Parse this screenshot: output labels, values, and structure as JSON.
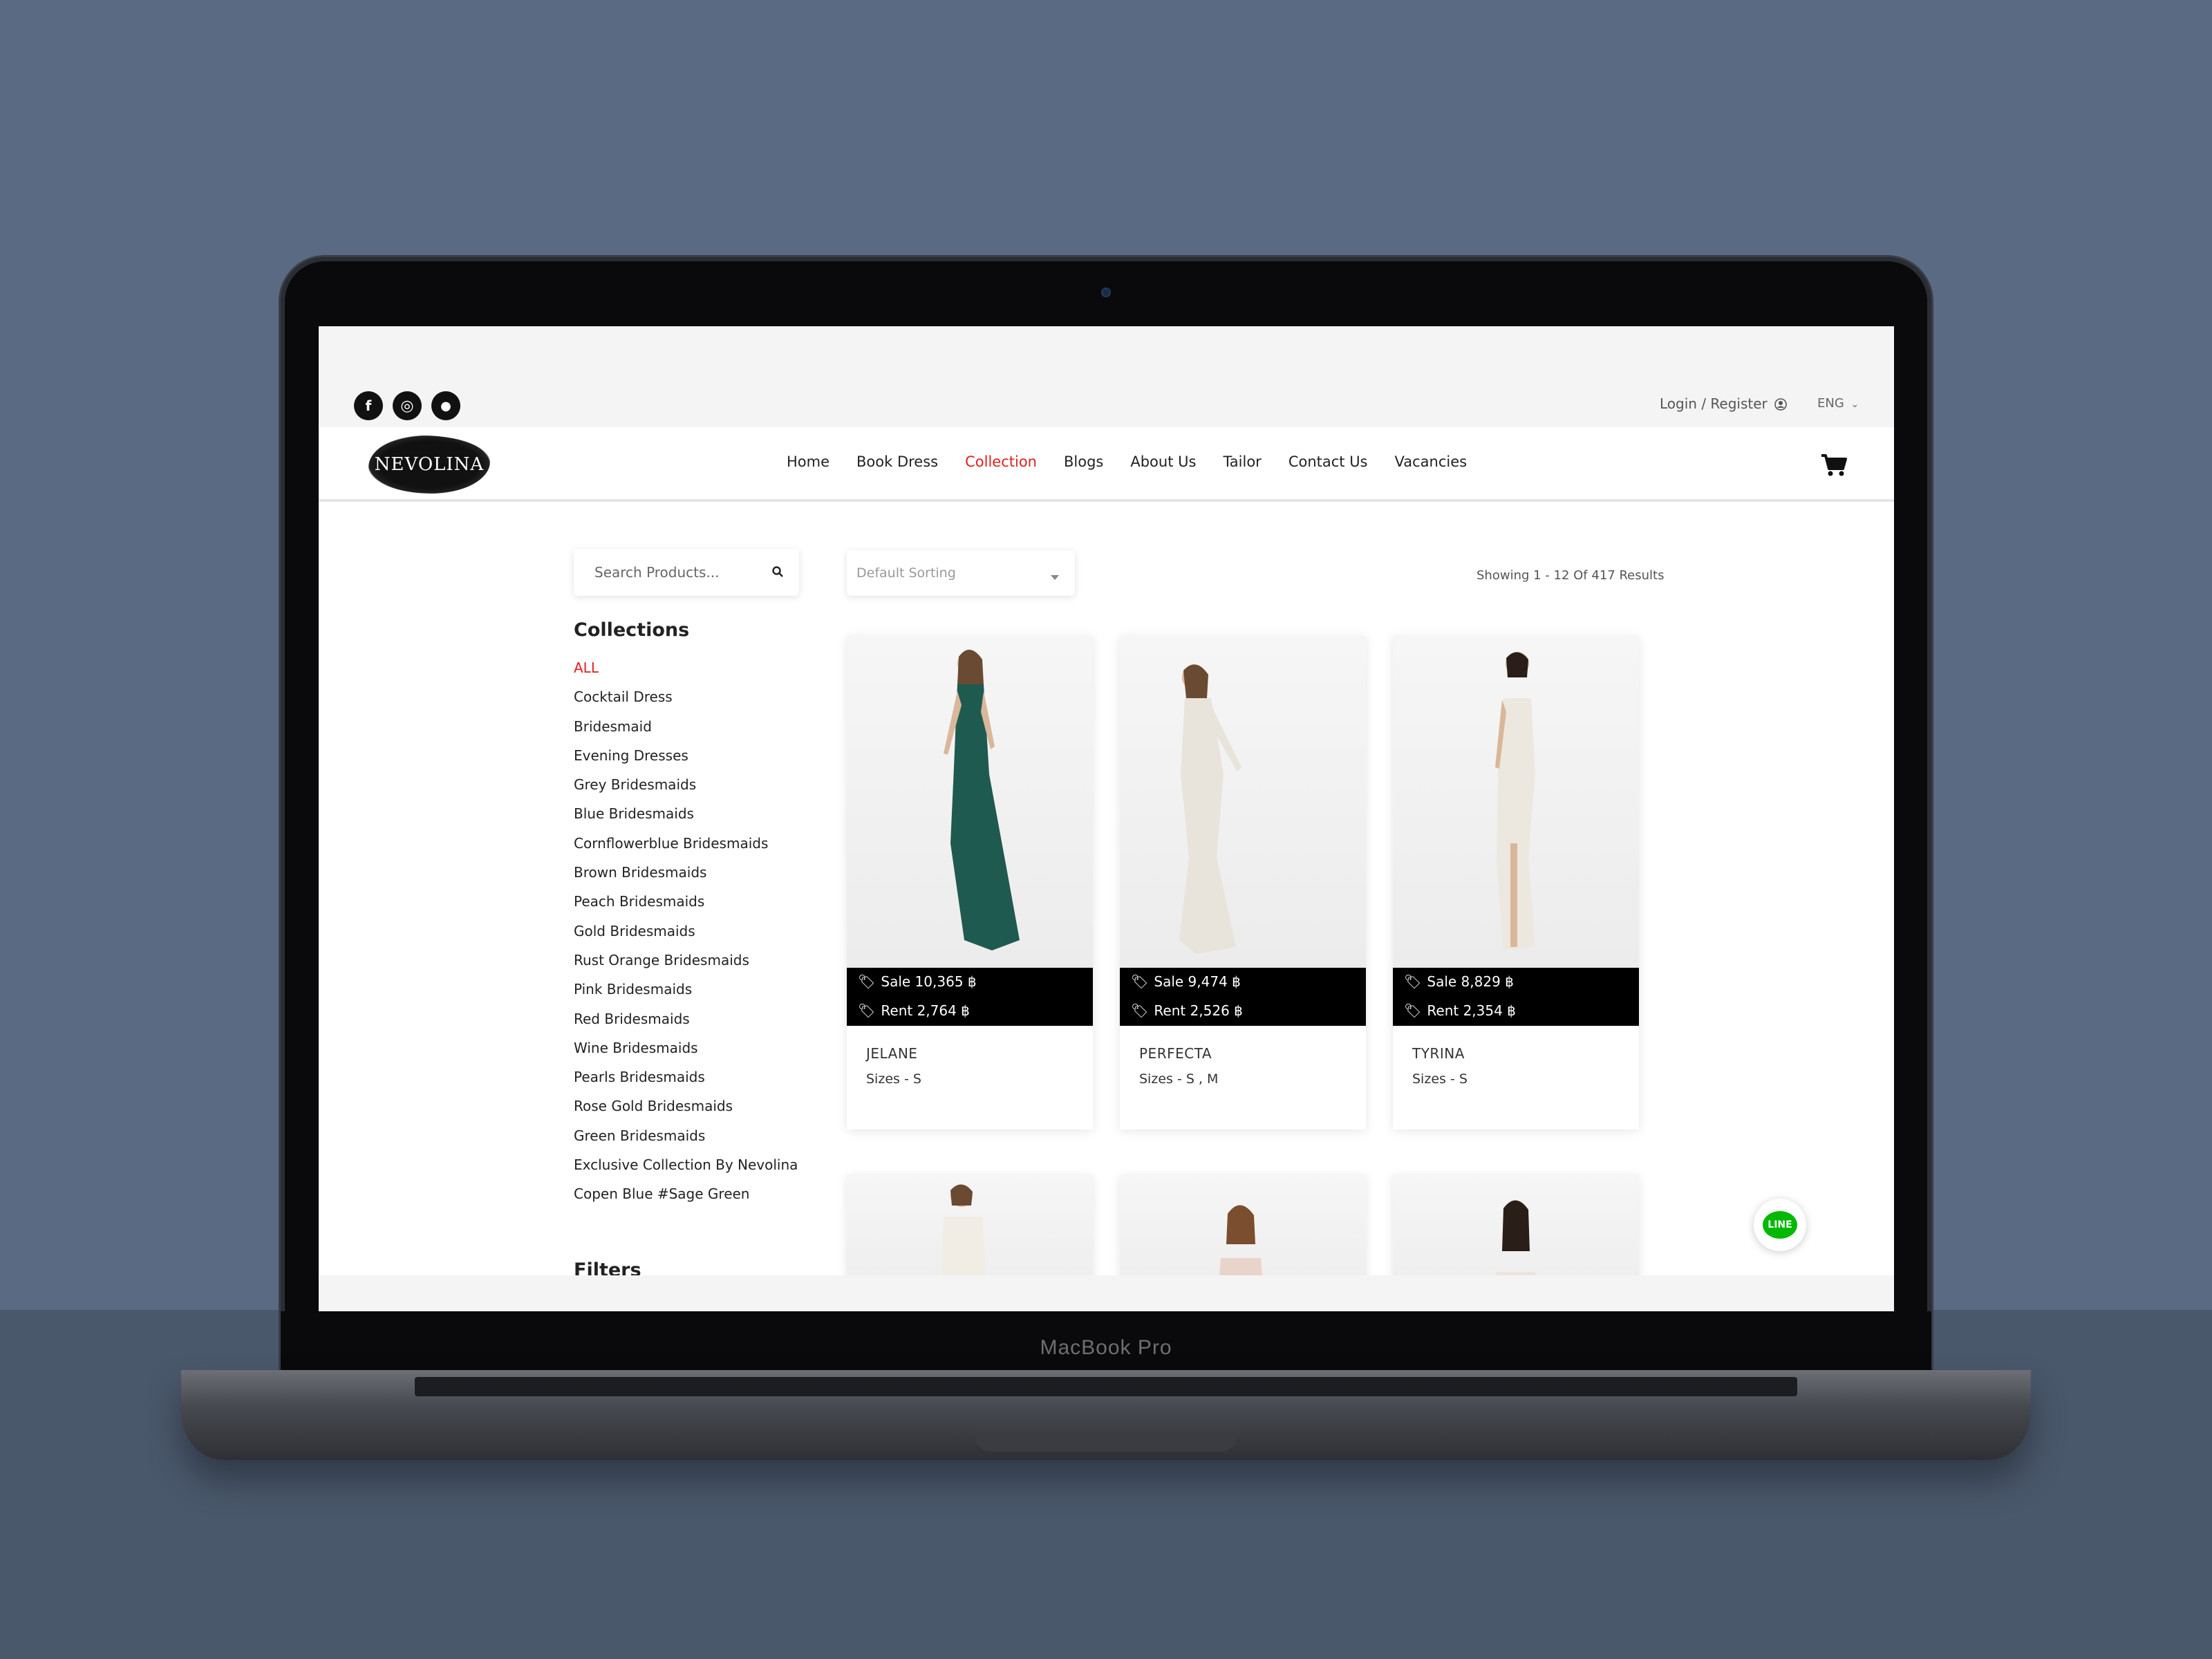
{
  "device": {
    "brand_label": "MacBook Pro"
  },
  "colors": {
    "accent": "#e02020",
    "background": "#5a6a82",
    "line_green": "#00b900"
  },
  "topbar": {
    "social_icons": [
      "facebook-icon",
      "instagram-icon",
      "line-icon"
    ],
    "social_glyphs": [
      "f",
      "◎",
      "●"
    ],
    "login_label": "Login / Register",
    "language_label": "ENG"
  },
  "navbar": {
    "logo_text": "NEVOLINA",
    "items": [
      {
        "label": "Home",
        "active": false
      },
      {
        "label": "Book Dress",
        "active": false
      },
      {
        "label": "Collection",
        "active": true
      },
      {
        "label": "Blogs",
        "active": false
      },
      {
        "label": "About Us",
        "active": false
      },
      {
        "label": "Tailor",
        "active": false
      },
      {
        "label": "Contact Us",
        "active": false
      },
      {
        "label": "Vacancies",
        "active": false
      }
    ]
  },
  "search": {
    "placeholder": "Search Products..."
  },
  "sidebar": {
    "collections_title": "Collections",
    "items": [
      "ALL",
      "Cocktail Dress",
      "Bridesmaid",
      "Evening Dresses",
      "Grey Bridesmaids",
      "Blue Bridesmaids",
      "Cornflowerblue Bridesmaids",
      "Brown Bridesmaids",
      "Peach Bridesmaids",
      "Gold Bridesmaids",
      "Rust Orange Bridesmaids",
      "Pink Bridesmaids",
      "Red Bridesmaids",
      "Wine Bridesmaids",
      "Pearls Bridesmaids",
      "Rose Gold Bridesmaids",
      "Green Bridesmaids",
      "Exclusive Collection By Nevolina",
      "Copen Blue #Sage Green"
    ],
    "active_index": 0,
    "filters_title": "Filters"
  },
  "toolbar": {
    "sort_label": "Default Sorting",
    "results_text": "Showing 1 - 12 Of 417 Results"
  },
  "products": [
    {
      "name": "JELANE",
      "sale": "Sale 10,365 ฿",
      "rent": "Rent 2,764 ฿",
      "sizes": "Sizes - S",
      "dress_color": "#1f5a50"
    },
    {
      "name": "PERFECTA",
      "sale": "Sale 9,474 ฿",
      "rent": "Rent 2,526 ฿",
      "sizes": "Sizes - S , M",
      "dress_color": "#e8e4dc"
    },
    {
      "name": "TYRINA",
      "sale": "Sale 8,829 ฿",
      "rent": "Rent 2,354 ฿",
      "sizes": "Sizes - S",
      "dress_color": "#ede8df"
    }
  ],
  "chat_button": {
    "label": "LINE"
  }
}
